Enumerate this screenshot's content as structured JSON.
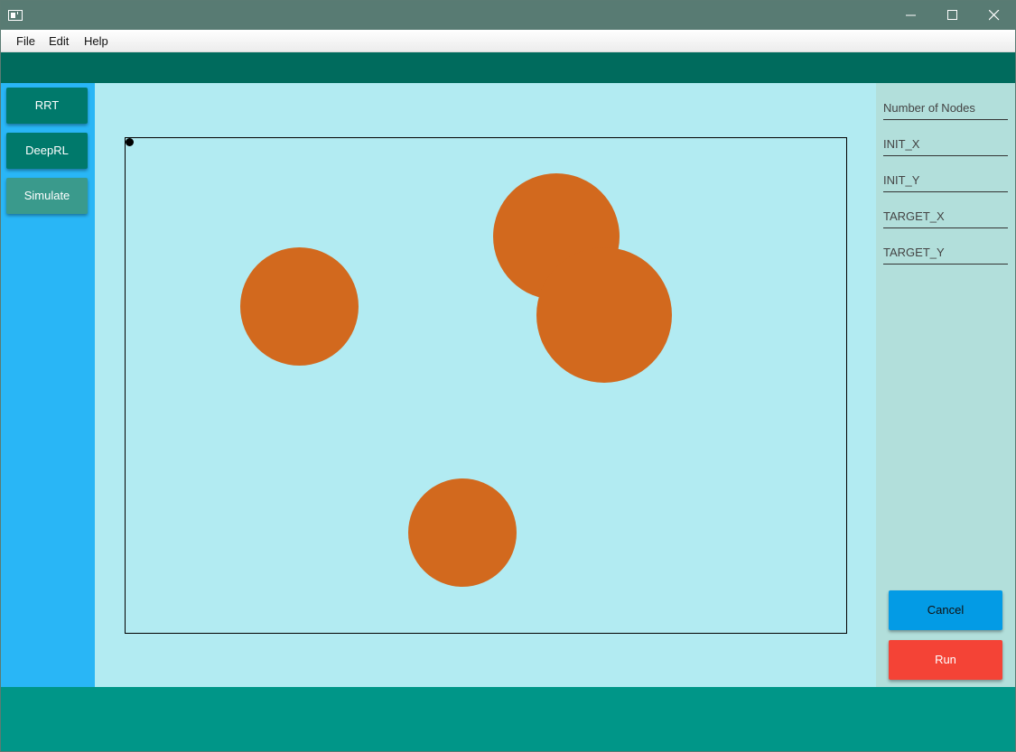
{
  "window": {
    "controls": {
      "minimize_icon": "minimize-icon",
      "maximize_icon": "maximize-icon",
      "close_icon": "close-icon"
    }
  },
  "menubar": {
    "items": [
      "File",
      "Edit",
      "Help"
    ]
  },
  "left_panel": {
    "buttons": [
      "RRT",
      "DeepRL",
      "Simulate"
    ]
  },
  "canvas": {
    "obstacle_color": "#d2691e",
    "background_color": "#b2ebf2",
    "obstacle_count": 4
  },
  "right_panel": {
    "fields": [
      {
        "placeholder": "Number of Nodes",
        "value": ""
      },
      {
        "placeholder": "INIT_X",
        "value": ""
      },
      {
        "placeholder": "INIT_Y",
        "value": ""
      },
      {
        "placeholder": "TARGET_X",
        "value": ""
      },
      {
        "placeholder": "TARGET_Y",
        "value": ""
      }
    ],
    "cancel_label": "Cancel",
    "run_label": "Run"
  },
  "colors": {
    "titlebar": "#587b73",
    "toolbar": "#006b5d",
    "left_panel": "#29b6f6",
    "right_panel": "#b2dfdb",
    "bottom_bar": "#009688",
    "nav_button": "#00796b",
    "cancel_button": "#039be5",
    "run_button": "#f44336"
  }
}
